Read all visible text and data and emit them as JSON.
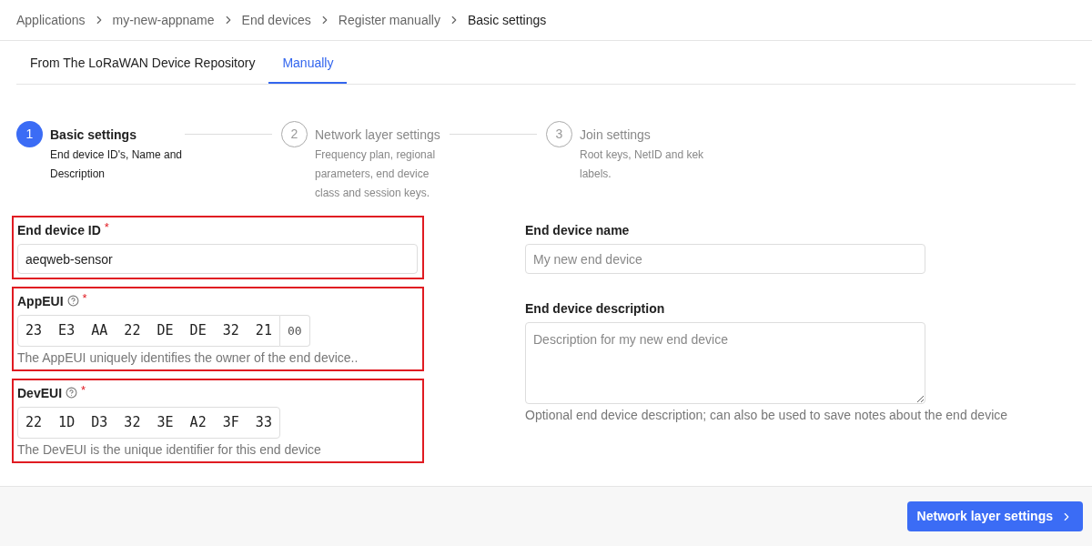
{
  "breadcrumbs": [
    {
      "label": "Applications",
      "current": false
    },
    {
      "label": "my-new-appname",
      "current": false
    },
    {
      "label": "End devices",
      "current": false
    },
    {
      "label": "Register manually",
      "current": false
    },
    {
      "label": "Basic settings",
      "current": true
    }
  ],
  "tabs": [
    {
      "label": "From The LoRaWAN Device Repository",
      "selected": false
    },
    {
      "label": "Manually",
      "selected": true
    }
  ],
  "steps": [
    {
      "number": "1",
      "title": "Basic settings",
      "description": "End device ID's, Name and Description",
      "selected": true
    },
    {
      "number": "2",
      "title": "Network layer settings",
      "description": "Frequency plan, regional parameters, end device class and session keys.",
      "selected": false
    },
    {
      "number": "3",
      "title": "Join settings",
      "description": "Root keys, NetID and kek labels.",
      "selected": false
    }
  ],
  "left_fields": [
    {
      "kind": "text",
      "label": "End device ID",
      "required_mark": "*",
      "highlighted": true,
      "value": "aeqweb-sensor"
    },
    {
      "kind": "eui",
      "label": "AppEUI",
      "required_mark": "*",
      "help_icon": true,
      "highlighted": true,
      "value": "23 E3 AA 22 DE DE 32 21",
      "addon": "00",
      "hint": "The AppEUI uniquely identifies the owner of the end device.."
    },
    {
      "kind": "eui",
      "label": "DevEUI",
      "required_mark": "*",
      "help_icon": true,
      "highlighted": true,
      "value": "22 1D D3 32 3E A2 3F 33",
      "hint": "The DevEUI is the unique identifier for this end device"
    }
  ],
  "right_fields": [
    {
      "kind": "text",
      "label": "End device name",
      "placeholder": "My new end device"
    },
    {
      "kind": "textarea",
      "label": "End device description",
      "placeholder": "Description for my new end device",
      "hint": "Optional end device description; can also be used to save notes about the end device"
    }
  ],
  "next_button": {
    "label": "Network layer settings"
  }
}
